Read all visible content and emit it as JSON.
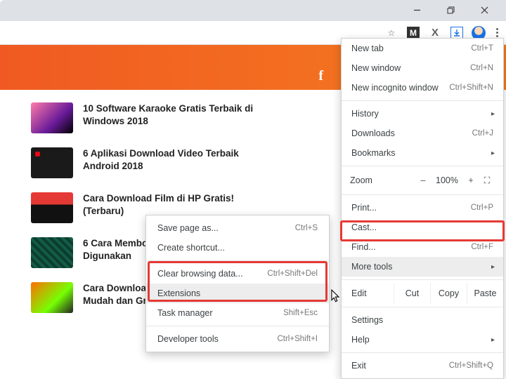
{
  "window": {
    "min_tip": "Minimize",
    "max_tip": "Restore",
    "close_tip": "Close"
  },
  "toolbar": {
    "star_tip": "Bookmark this page",
    "m_label": "M",
    "x_label": "X",
    "dl_tip": "Downloads",
    "menu_tip": "Customize and control Google Chrome"
  },
  "banner": {
    "fb": "f"
  },
  "articles": [
    "10 Software Karaoke Gratis Terbaik di Windows 2018",
    "6 Aplikasi Download Video Terbaik Android 2018",
    "Cara Download Film di HP Gratis! (Terbaru)",
    "6 Cara Membobol WiFi yang Banyak Digunakan",
    "Cara Download Lagu Di HP Android Mudah dan Gratis!"
  ],
  "menu": {
    "new_tab": {
      "label": "New tab",
      "shortcut": "Ctrl+T"
    },
    "new_window": {
      "label": "New window",
      "shortcut": "Ctrl+N"
    },
    "incognito": {
      "label": "New incognito window",
      "shortcut": "Ctrl+Shift+N"
    },
    "history": {
      "label": "History"
    },
    "downloads": {
      "label": "Downloads",
      "shortcut": "Ctrl+J"
    },
    "bookmarks": {
      "label": "Bookmarks"
    },
    "zoom": {
      "label": "Zoom",
      "minus": "–",
      "value": "100%",
      "plus": "+",
      "fullscreen": "⛶"
    },
    "print": {
      "label": "Print...",
      "shortcut": "Ctrl+P"
    },
    "cast": {
      "label": "Cast..."
    },
    "find": {
      "label": "Find...",
      "shortcut": "Ctrl+F"
    },
    "more_tools": {
      "label": "More tools"
    },
    "edit": {
      "label": "Edit",
      "cut": "Cut",
      "copy": "Copy",
      "paste": "Paste"
    },
    "settings": {
      "label": "Settings"
    },
    "help": {
      "label": "Help"
    },
    "exit": {
      "label": "Exit",
      "shortcut": "Ctrl+Shift+Q"
    }
  },
  "submenu": {
    "save_page": {
      "label": "Save page as...",
      "shortcut": "Ctrl+S"
    },
    "create_shortcut": {
      "label": "Create shortcut..."
    },
    "clear_data": {
      "label": "Clear browsing data...",
      "shortcut": "Ctrl+Shift+Del"
    },
    "extensions": {
      "label": "Extensions"
    },
    "task_manager": {
      "label": "Task manager",
      "shortcut": "Shift+Esc"
    },
    "dev_tools": {
      "label": "Developer tools",
      "shortcut": "Ctrl+Shift+I"
    }
  }
}
